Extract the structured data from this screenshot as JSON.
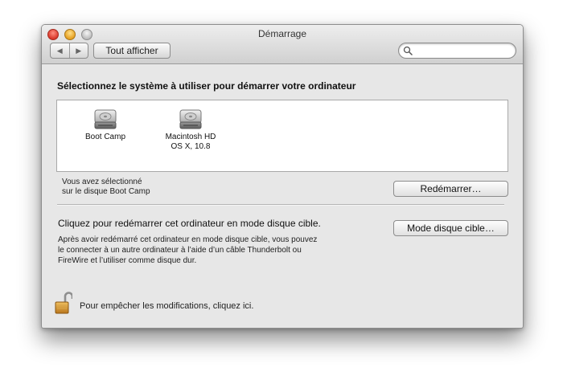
{
  "window": {
    "title": "Démarrage"
  },
  "toolbar": {
    "back_icon": "chevron-left",
    "forward_icon": "chevron-right",
    "show_all_label": "Tout afficher",
    "search_placeholder": "",
    "search_icon": "magnifier"
  },
  "main": {
    "heading": "Sélectionnez le système à utiliser pour démarrer votre ordinateur",
    "disks": [
      {
        "label": "Boot Camp",
        "icon": "hard-disk"
      },
      {
        "label": "Macintosh HD\nOS X, 10.8",
        "icon": "hard-disk"
      }
    ],
    "selection_line1": "Vous avez sélectionné",
    "selection_line2": "sur le disque Boot Camp",
    "restart_label": "Redémarrer…",
    "target_title": "Cliquez pour redémarrer cet ordinateur en mode disque cible.",
    "target_line1": "Après avoir redémarré cet ordinateur en mode disque cible, vous pouvez",
    "target_line2": "le connecter à un autre ordinateur à l’aide d’un câble Thunderbolt ou",
    "target_line3": "FireWire et l’utiliser comme disque dur.",
    "target_button_label": "Mode disque cible…",
    "lock_text": "Pour empêcher les modifications, cliquez ici.",
    "lock_icon": "open-padlock"
  }
}
